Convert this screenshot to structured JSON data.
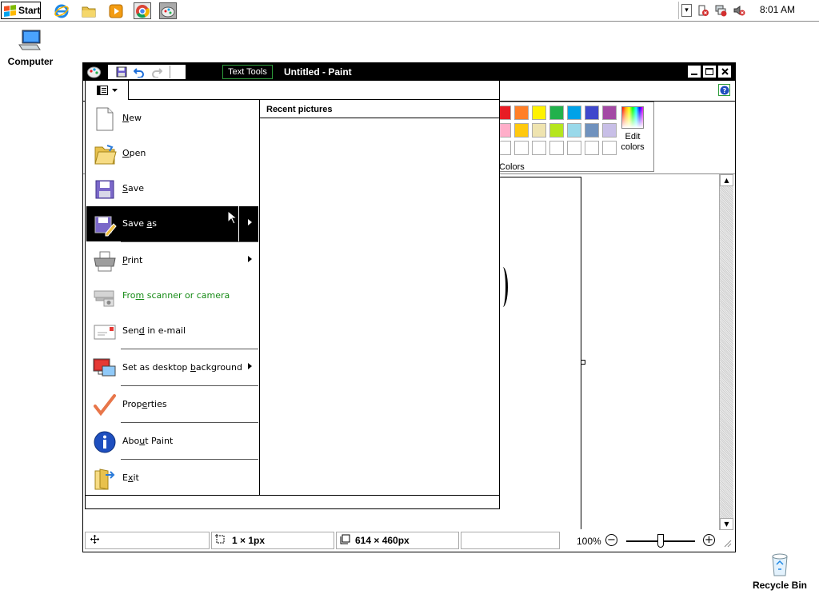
{
  "taskbar": {
    "start_label": "Start",
    "clock": "8:01 AM",
    "icons": [
      "internet-explorer-icon",
      "file-explorer-icon",
      "media-player-icon",
      "chrome-icon",
      "paint-taskbar-icon"
    ]
  },
  "desktop": {
    "computer_label": "Computer",
    "recycle_bin_label": "Recycle Bin"
  },
  "window": {
    "title": "Untitled - Paint",
    "contextual_tab": "Text Tools"
  },
  "ribbon": {
    "colors_group_label": "Colors",
    "edit_colors_label_1": "Edit",
    "edit_colors_label_2": "colors",
    "palette_row1": [
      "#e81c24",
      "#ff7f27",
      "#fff200",
      "#22b14c",
      "#00a2e8",
      "#3f48cc",
      "#a349a4"
    ],
    "palette_row2": [
      "#ffaec9",
      "#ffc90e",
      "#efe4b0",
      "#b5e61d",
      "#99d9ea",
      "#7092be",
      "#c8bfe7"
    ],
    "palette_row3": [
      "#ffffff",
      "#ffffff",
      "#ffffff",
      "#ffffff",
      "#ffffff",
      "#ffffff",
      "#ffffff"
    ]
  },
  "file_menu": {
    "recent_title": "Recent pictures",
    "items": {
      "new": {
        "pre": "",
        "u": "N",
        "post": "ew"
      },
      "open": {
        "pre": "",
        "u": "O",
        "post": "pen"
      },
      "save": {
        "pre": "",
        "u": "S",
        "post": "ave"
      },
      "save_as": {
        "pre": "Save ",
        "u": "a",
        "post": "s"
      },
      "print": {
        "pre": "",
        "u": "P",
        "post": "rint"
      },
      "scanner": {
        "pre": "Fro",
        "u": "m",
        "post": " scanner or camera"
      },
      "email": {
        "pre": "Sen",
        "u": "d",
        "post": " in e-mail"
      },
      "desktop_bg": {
        "pre": "Set as desktop ",
        "u": "b",
        "post": "ackground"
      },
      "properties": {
        "pre": "Prop",
        "u": "e",
        "post": "rties"
      },
      "about": {
        "pre": "Abo",
        "u": "u",
        "post": "t Paint"
      },
      "exit": {
        "pre": "E",
        "u": "x",
        "post": "it"
      }
    }
  },
  "statusbar": {
    "selection_size": "1 × 1px",
    "canvas_size": "614 × 460px",
    "zoom": "100%"
  }
}
